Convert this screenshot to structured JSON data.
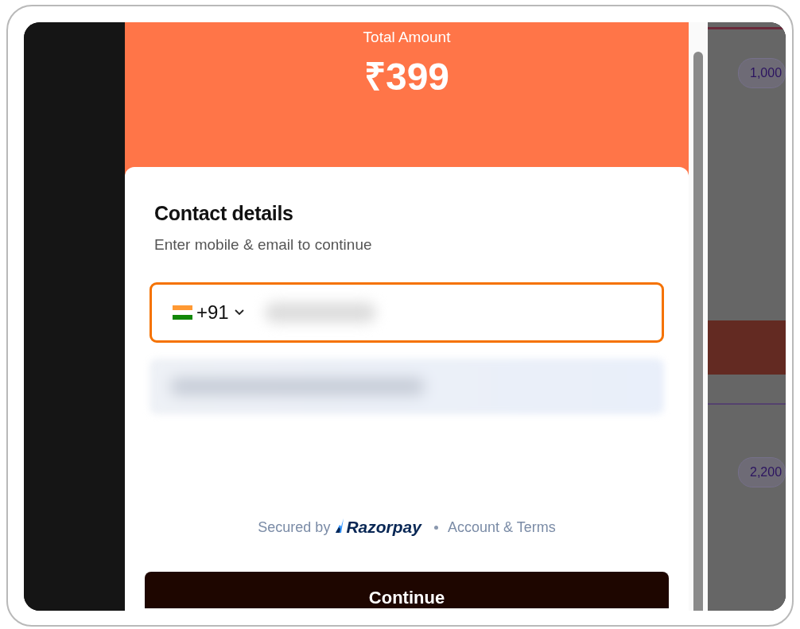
{
  "header": {
    "label": "Total Amount",
    "amount": "₹399"
  },
  "contact": {
    "title": "Contact details",
    "subtitle": "Enter mobile & email to continue",
    "phone": {
      "country_code": "+91",
      "focused": true
    },
    "email": {
      "focused": false
    }
  },
  "footer": {
    "secured_by": "Secured by",
    "brand": "Razorpay",
    "link": "Account & Terms"
  },
  "button": "Continue",
  "background_chips": [
    "1,000",
    "2,200"
  ]
}
